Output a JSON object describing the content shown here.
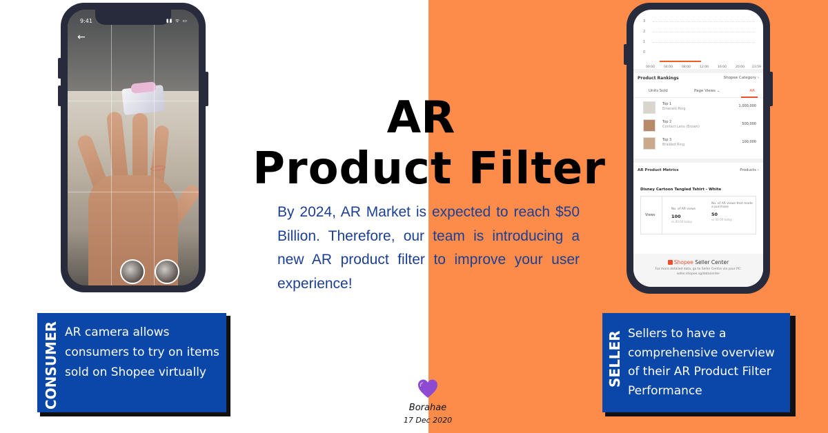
{
  "title": {
    "line1": "AR",
    "line2": "Product Filter"
  },
  "description": "By 2024, AR Market is expected to reach $50 Billion. Therefore, our team is introducing a new AR product filter to improve your user experience!",
  "consumer_card": {
    "label": "CONSUMER",
    "text": "AR camera allows consumers to try on items sold on Shopee virtually"
  },
  "seller_card": {
    "label": "SELLER",
    "text": "Sellers to have a comprehensive overview of their AR Product Filter Performance"
  },
  "signature": {
    "heart_icon": "purple-heart-icon",
    "name": "Borahae",
    "date": "17 Dec 2020"
  },
  "consumer_phone": {
    "time": "9:41",
    "status_icons": "▮▮ ᯤ ▭"
  },
  "seller_phone": {
    "y_ticks": [
      "3",
      "2",
      "1",
      "0"
    ],
    "x_ticks": [
      "00:00",
      "04:00",
      "08:00",
      "12:00",
      "16:00",
      "20:00",
      "23:59"
    ],
    "rankings_title": "Product Rankings",
    "rankings_category": "Shopee Category ›",
    "tabs": [
      "Units Sold",
      "Page Views ⌄",
      "AR"
    ],
    "rankings": [
      {
        "rank": "Top 1",
        "name": "Emerald Ring",
        "value": "1,000,000"
      },
      {
        "rank": "Top 2",
        "name": "Contact Lens (Brown)",
        "value": "500,000"
      },
      {
        "rank": "Top 3",
        "name": "Braided Ring",
        "value": "100,000"
      }
    ],
    "metrics_title": "AR Product Metrics",
    "metrics_link": "Products ›",
    "metrics_product": "Disney Cartoon Tangled Tshirt - White",
    "metrics_row_label": "Views",
    "metric_a": {
      "label": "No. of AR views",
      "value": "100",
      "note": "vs 00:00 today"
    },
    "metric_b": {
      "label": "No. of AR views that made a purchase",
      "value": "50",
      "note": "vs 00:00 today"
    },
    "footer_brand": "Shopee",
    "footer_suffix": " Seller Center",
    "footer_note": "For more detailed data, go to Seller Centre via your PC: seller.shopee.sg/datacenter"
  },
  "colors": {
    "orange_bg": "#fd8c4b",
    "card_blue": "#0b47a8",
    "desc_blue": "#1c3f94",
    "shopee_orange": "#ee4d2d"
  }
}
